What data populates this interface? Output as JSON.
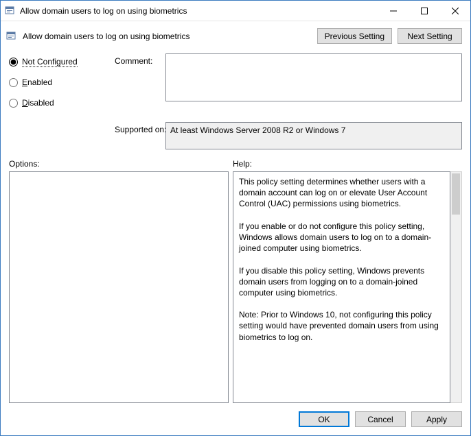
{
  "window": {
    "title": "Allow domain users to log on using biometrics"
  },
  "header": {
    "title": "Allow domain users to log on using biometrics",
    "previous_setting": "Previous Setting",
    "next_setting": "Next Setting"
  },
  "state": {
    "not_configured": "Not Configured",
    "enabled": "Enabled",
    "disabled": "Disabled",
    "selected": "not_configured"
  },
  "labels": {
    "comment": "Comment:",
    "supported_on": "Supported on:",
    "options": "Options:",
    "help": "Help:"
  },
  "comment_value": "",
  "supported_on_value": "At least Windows Server 2008 R2 or Windows 7",
  "options_content": "",
  "help_text": "This policy setting determines whether users with a domain account can log on or elevate User Account Control (UAC) permissions using biometrics.\n\nIf you enable or do not configure this policy setting, Windows allows domain users to log on to a domain-joined computer using biometrics.\n\nIf you disable this policy setting, Windows prevents domain users from logging on to a domain-joined computer using biometrics.\n\nNote: Prior to Windows 10, not configuring this policy setting would have prevented domain users from using biometrics to log on.",
  "footer": {
    "ok": "OK",
    "cancel": "Cancel",
    "apply": "Apply"
  }
}
